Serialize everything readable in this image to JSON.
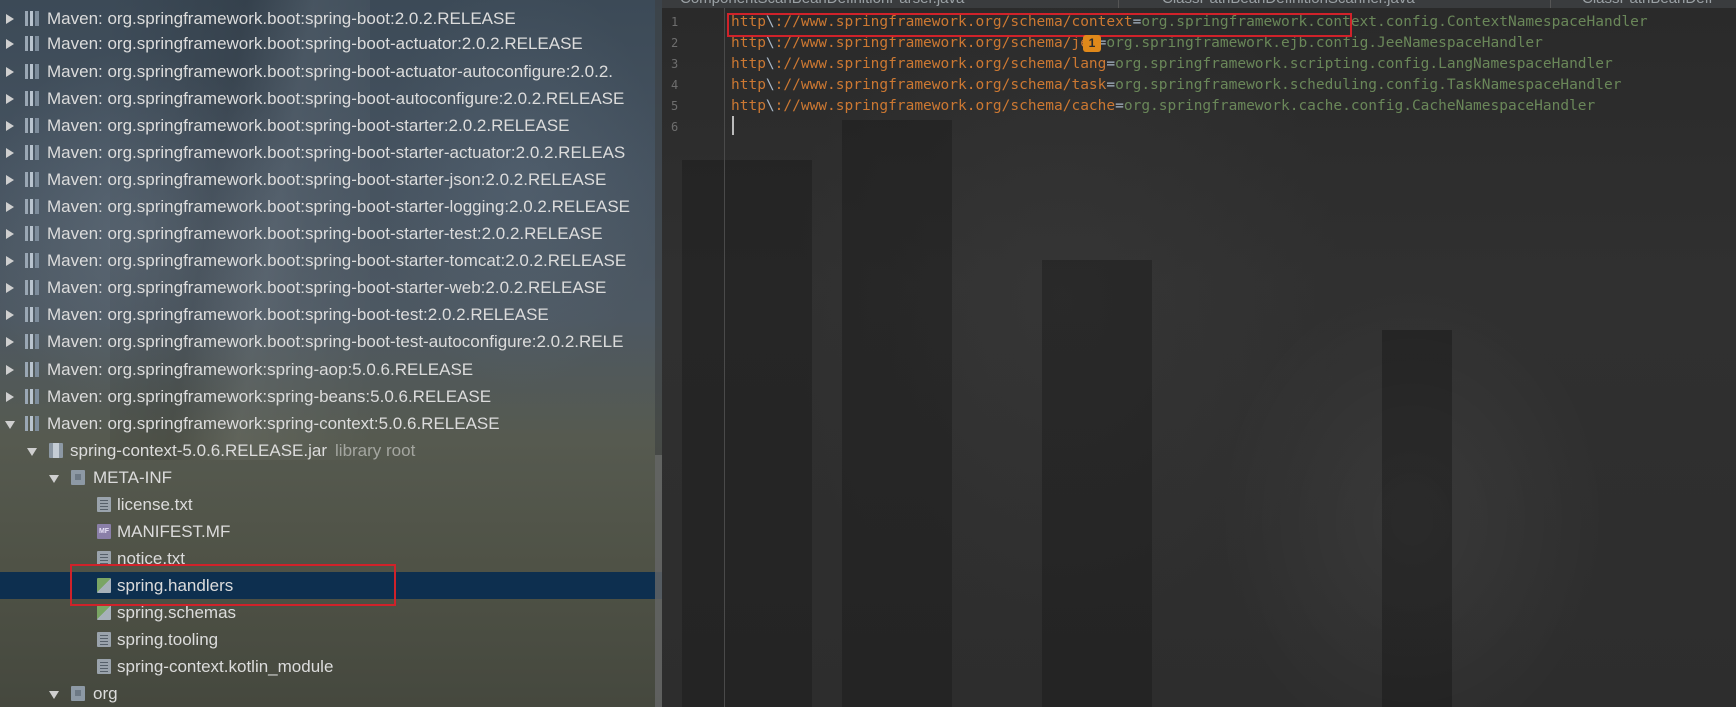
{
  "project_tree": {
    "items": [
      {
        "label": "Maven: org.springframework.boot:spring-boot:2.0.2.RELEASE",
        "expanded": false
      },
      {
        "label": "Maven: org.springframework.boot:spring-boot-actuator:2.0.2.RELEASE",
        "expanded": false
      },
      {
        "label": "Maven: org.springframework.boot:spring-boot-actuator-autoconfigure:2.0.2.",
        "expanded": false
      },
      {
        "label": "Maven: org.springframework.boot:spring-boot-autoconfigure:2.0.2.RELEASE",
        "expanded": false
      },
      {
        "label": "Maven: org.springframework.boot:spring-boot-starter:2.0.2.RELEASE",
        "expanded": false
      },
      {
        "label": "Maven: org.springframework.boot:spring-boot-starter-actuator:2.0.2.RELEAS",
        "expanded": false
      },
      {
        "label": "Maven: org.springframework.boot:spring-boot-starter-json:2.0.2.RELEASE",
        "expanded": false
      },
      {
        "label": "Maven: org.springframework.boot:spring-boot-starter-logging:2.0.2.RELEASE",
        "expanded": false
      },
      {
        "label": "Maven: org.springframework.boot:spring-boot-starter-test:2.0.2.RELEASE",
        "expanded": false
      },
      {
        "label": "Maven: org.springframework.boot:spring-boot-starter-tomcat:2.0.2.RELEASE",
        "expanded": false
      },
      {
        "label": "Maven: org.springframework.boot:spring-boot-starter-web:2.0.2.RELEASE",
        "expanded": false
      },
      {
        "label": "Maven: org.springframework.boot:spring-boot-test:2.0.2.RELEASE",
        "expanded": false
      },
      {
        "label": "Maven: org.springframework.boot:spring-boot-test-autoconfigure:2.0.2.RELE",
        "expanded": false
      },
      {
        "label": "Maven: org.springframework:spring-aop:5.0.6.RELEASE",
        "expanded": false
      },
      {
        "label": "Maven: org.springframework:spring-beans:5.0.6.RELEASE",
        "expanded": false
      },
      {
        "label": "Maven: org.springframework:spring-context:5.0.6.RELEASE",
        "expanded": true
      }
    ],
    "jar": {
      "label": "spring-context-5.0.6.RELEASE.jar",
      "suffix": "library root"
    },
    "meta_inf": {
      "label": "META-INF",
      "files": [
        {
          "label": "license.txt",
          "icon": "text-file-icon"
        },
        {
          "label": "MANIFEST.MF",
          "icon": "manifest-file-icon"
        },
        {
          "label": "notice.txt",
          "icon": "text-file-icon"
        },
        {
          "label": "spring.handlers",
          "icon": "spring-properties-icon",
          "selected": true
        },
        {
          "label": "spring.schemas",
          "icon": "spring-properties-icon"
        },
        {
          "label": "spring.tooling",
          "icon": "text-file-icon"
        },
        {
          "label": "spring-context.kotlin_module",
          "icon": "text-file-icon"
        }
      ]
    },
    "org_folder": {
      "label": "org"
    }
  },
  "editor": {
    "tabs": [
      {
        "label": "ComponentScanBeanDefinitionParser.java"
      },
      {
        "label": "ClassPathBeanDefinitionScanner.java"
      },
      {
        "label": "ClassPathBeanDefi"
      }
    ],
    "lines": [
      {
        "number": "1",
        "key_prefix": "http",
        "key_escape": "\\",
        "key_rest": "://www.springframework.org/schema/context",
        "eq": "=",
        "value": "org.springframework.context.config.ContextNamespaceHandler"
      },
      {
        "number": "2",
        "key_prefix": "http",
        "key_escape": "\\",
        "key_rest": "://www.springframework.org/schema/jee",
        "eq": "=",
        "value": "org.springframework.ejb.config.JeeNamespaceHandler"
      },
      {
        "number": "3",
        "key_prefix": "http",
        "key_escape": "\\",
        "key_rest": "://www.springframework.org/schema/lang",
        "eq": "=",
        "value": "org.springframework.scripting.config.LangNamespaceHandler"
      },
      {
        "number": "4",
        "key_prefix": "http",
        "key_escape": "\\",
        "key_rest": "://www.springframework.org/schema/task",
        "eq": "=",
        "value": "org.springframework.scheduling.config.TaskNamespaceHandler"
      },
      {
        "number": "5",
        "key_prefix": "http",
        "key_escape": "\\",
        "key_rest": "://www.springframework.org/schema/cache",
        "eq": "=",
        "value": "org.springframework.cache.config.CacheNamespaceHandler"
      },
      {
        "number": "6"
      }
    ],
    "annotation_badge": "1"
  },
  "colors": {
    "highlight_box": "#d0222a",
    "selection": "#0d2f4f",
    "key": "#cc7832",
    "value": "#6a8759",
    "badge": "#e0891a"
  }
}
